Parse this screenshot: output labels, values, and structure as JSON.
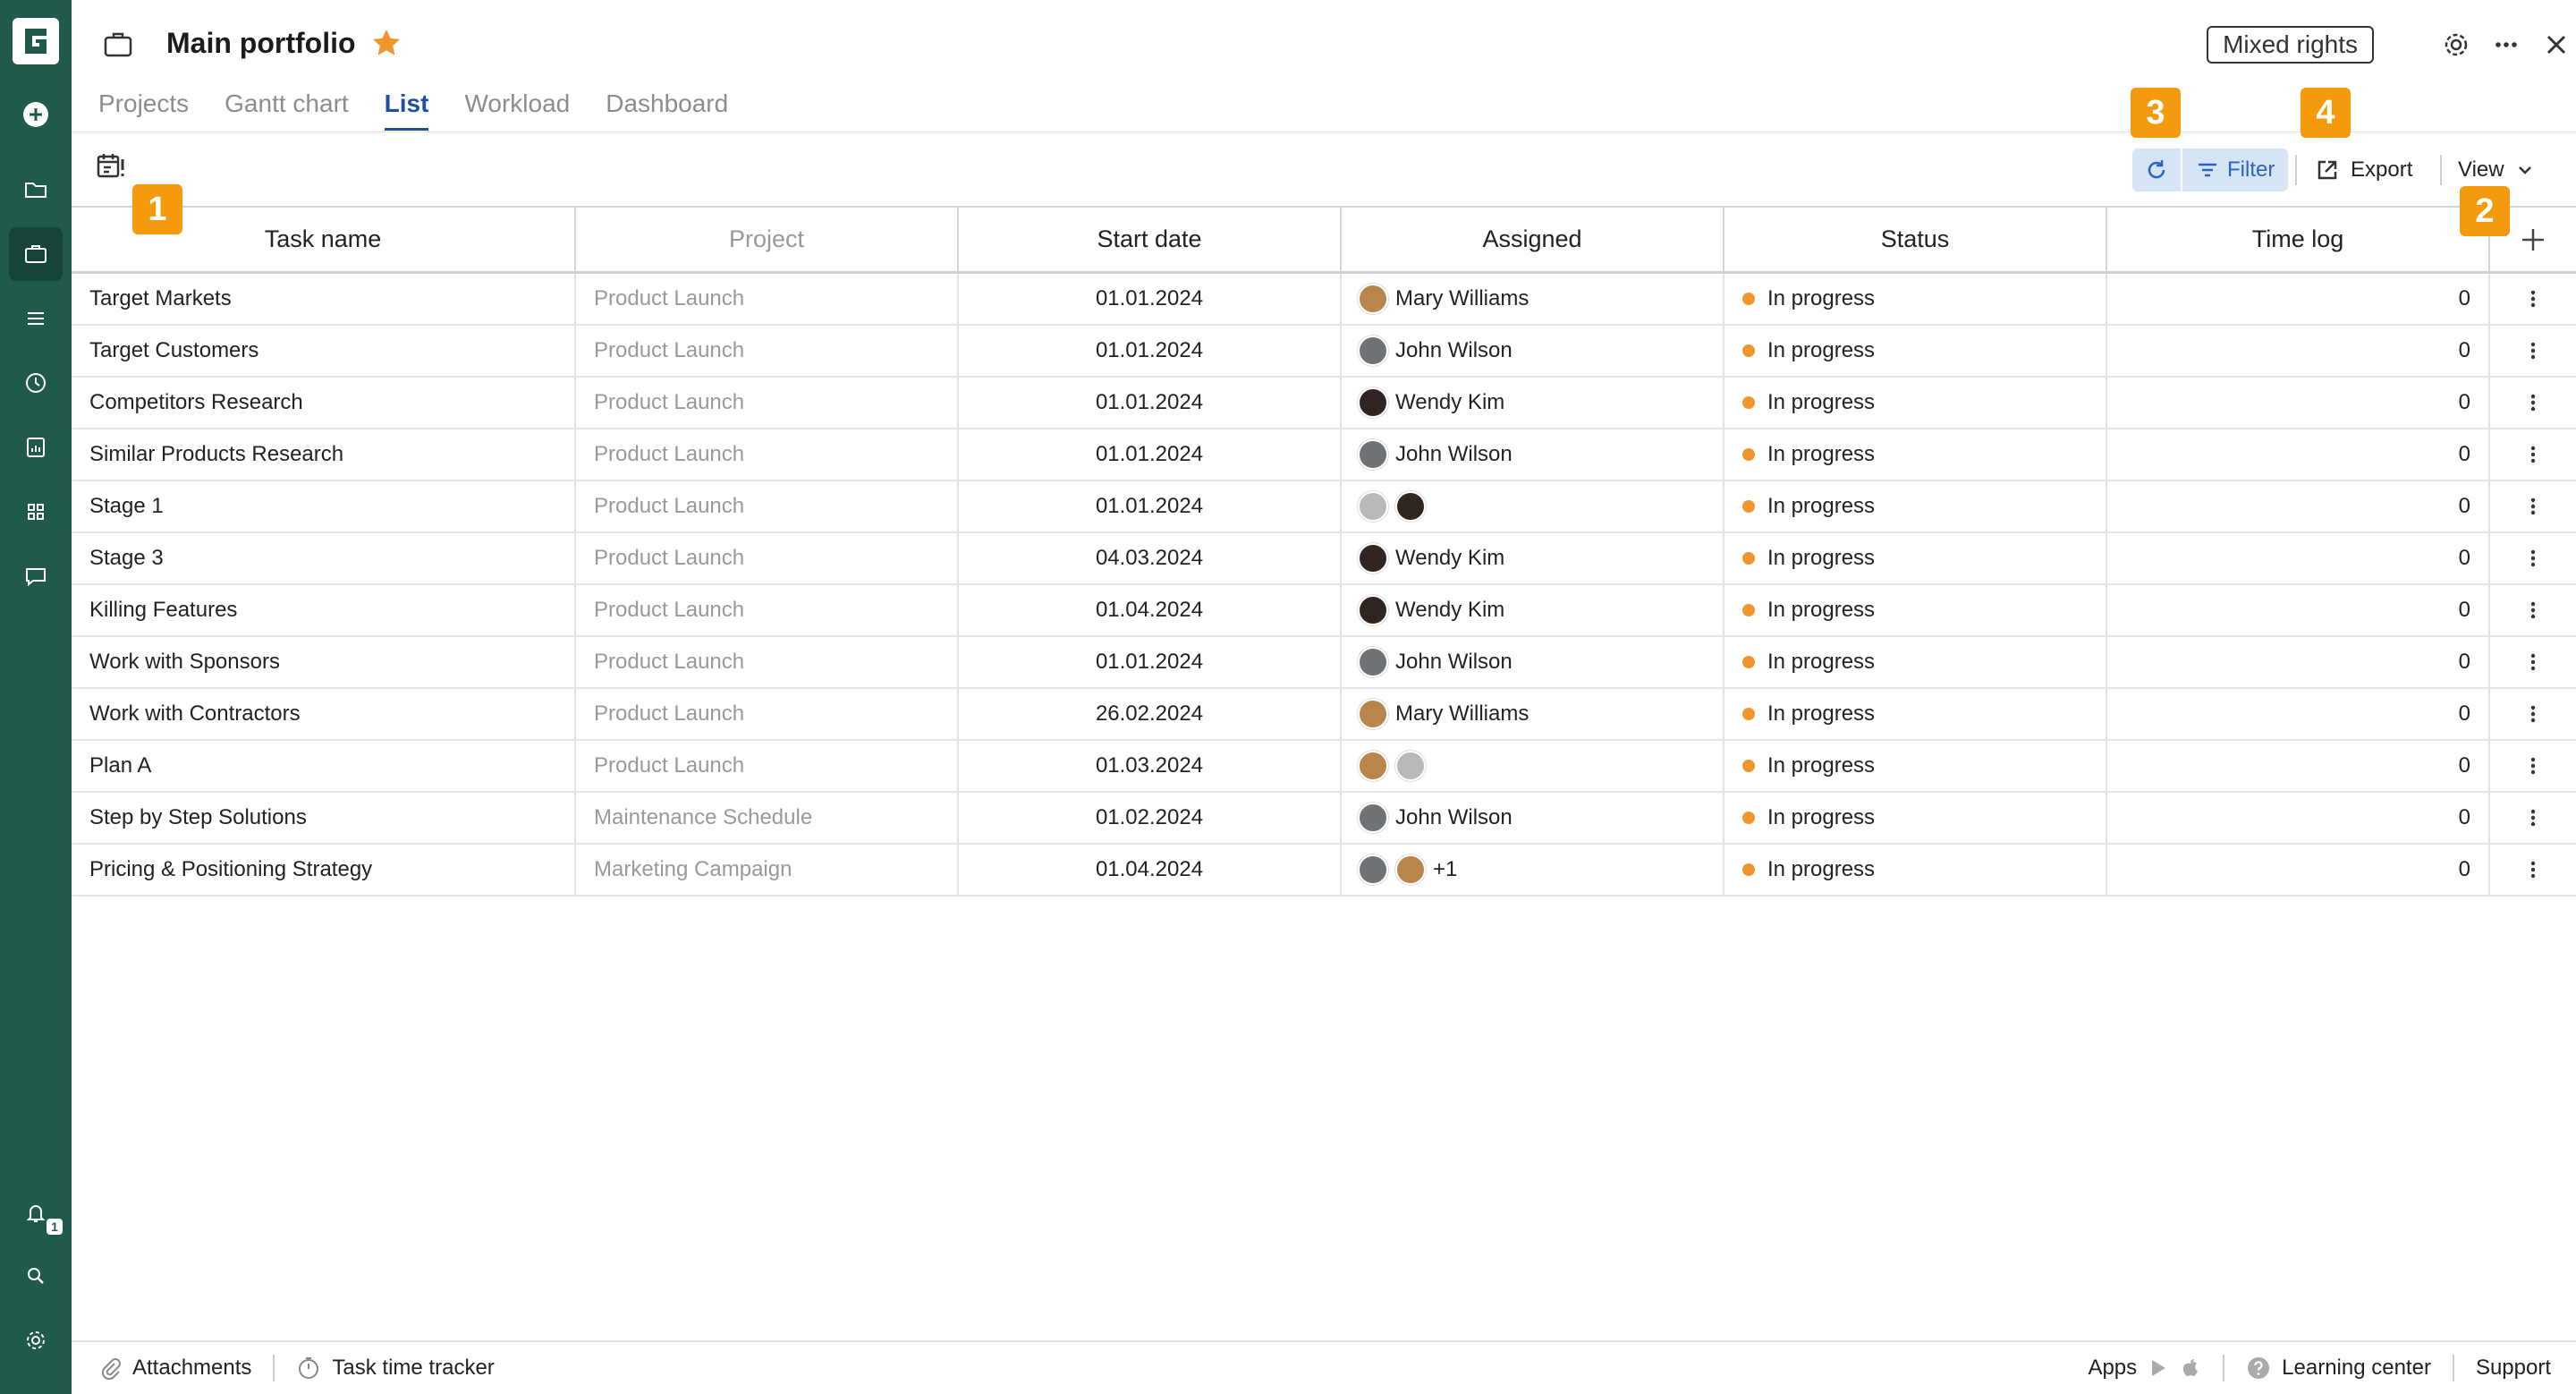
{
  "header": {
    "title": "Main portfolio",
    "mixed_rights": "Mixed rights"
  },
  "tabs": [
    {
      "label": "Projects",
      "active": false
    },
    {
      "label": "Gantt chart",
      "active": false
    },
    {
      "label": "List",
      "active": true
    },
    {
      "label": "Workload",
      "active": false
    },
    {
      "label": "Dashboard",
      "active": false
    }
  ],
  "toolbar": {
    "filter_label": "Filter",
    "export_label": "Export",
    "view_label": "View"
  },
  "markers": [
    "1",
    "2",
    "3",
    "4"
  ],
  "table": {
    "columns": [
      "Task name",
      "Project",
      "Start date",
      "Assigned",
      "Status",
      "Time log"
    ],
    "rows": [
      {
        "task": "Target Markets",
        "project": "Product Launch",
        "start": "01.01.2024",
        "assignees": [
          "mary"
        ],
        "assigned_label": "Mary Williams",
        "status": "In progress",
        "time_log": "0"
      },
      {
        "task": "Target Customers",
        "project": "Product Launch",
        "start": "01.01.2024",
        "assignees": [
          "john"
        ],
        "assigned_label": "John Wilson",
        "status": "In progress",
        "time_log": "0"
      },
      {
        "task": "Competitors Research",
        "project": "Product Launch",
        "start": "01.01.2024",
        "assignees": [
          "wendy"
        ],
        "assigned_label": "Wendy Kim",
        "status": "In progress",
        "time_log": "0"
      },
      {
        "task": "Similar Products Research",
        "project": "Product Launch",
        "start": "01.01.2024",
        "assignees": [
          "john"
        ],
        "assigned_label": "John Wilson",
        "status": "In progress",
        "time_log": "0"
      },
      {
        "task": "Stage 1",
        "project": "Product Launch",
        "start": "01.01.2024",
        "assignees": [
          "grey",
          "wendy"
        ],
        "assigned_label": "",
        "status": "In progress",
        "time_log": "0"
      },
      {
        "task": "Stage 3",
        "project": "Product Launch",
        "start": "04.03.2024",
        "assignees": [
          "wendy"
        ],
        "assigned_label": "Wendy Kim",
        "status": "In progress",
        "time_log": "0"
      },
      {
        "task": "Killing Features",
        "project": "Product Launch",
        "start": "01.04.2024",
        "assignees": [
          "wendy"
        ],
        "assigned_label": "Wendy Kim",
        "status": "In progress",
        "time_log": "0"
      },
      {
        "task": "Work with Sponsors",
        "project": "Product Launch",
        "start": "01.01.2024",
        "assignees": [
          "john"
        ],
        "assigned_label": "John Wilson",
        "status": "In progress",
        "time_log": "0"
      },
      {
        "task": "Work with Contractors",
        "project": "Product Launch",
        "start": "26.02.2024",
        "assignees": [
          "mary"
        ],
        "assigned_label": "Mary Williams",
        "status": "In progress",
        "time_log": "0"
      },
      {
        "task": "Plan A",
        "project": "Product Launch",
        "start": "01.03.2024",
        "assignees": [
          "mary",
          "grey"
        ],
        "assigned_label": "",
        "status": "In progress",
        "time_log": "0"
      },
      {
        "task": "Step by Step Solutions",
        "project": "Maintenance Schedule",
        "start": "01.02.2024",
        "assignees": [
          "john"
        ],
        "assigned_label": "John Wilson",
        "status": "In progress",
        "time_log": "0"
      },
      {
        "task": "Pricing & Positioning Strategy",
        "project": "Marketing Campaign",
        "start": "01.04.2024",
        "assignees": [
          "john",
          "mary"
        ],
        "assigned_label": "+1",
        "status": "In progress",
        "time_log": "0"
      }
    ]
  },
  "avatar_colors": {
    "mary": "#b8864a",
    "john": "#6e7378",
    "wendy": "#2f2622",
    "grey": "#b9b9b9"
  },
  "status_color": "#f0962c",
  "sidebar": {
    "notification_count": "1"
  },
  "footer": {
    "attachments": "Attachments",
    "time_tracker": "Task time tracker",
    "apps": "Apps",
    "learning_center": "Learning center",
    "support": "Support"
  }
}
